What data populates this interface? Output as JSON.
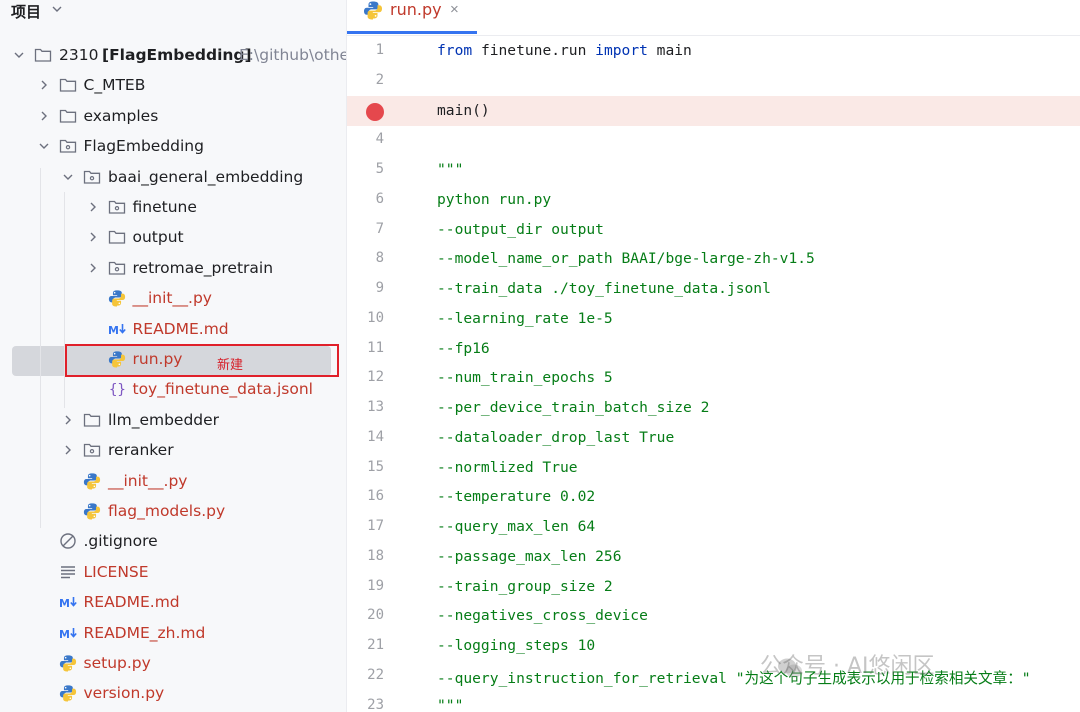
{
  "panel": {
    "title": "项目"
  },
  "tree": [
    {
      "label": "2310",
      "bold_label": "[FlagEmbedding]",
      "path": "E:\\github\\othe",
      "type": "folder",
      "depth": 0,
      "expanded": true
    },
    {
      "label": "C_MTEB",
      "type": "folder",
      "depth": 1,
      "expanded": false
    },
    {
      "label": "examples",
      "type": "folder",
      "depth": 1,
      "expanded": false
    },
    {
      "label": "FlagEmbedding",
      "type": "package",
      "depth": 1,
      "expanded": true
    },
    {
      "label": "baai_general_embedding",
      "type": "package",
      "depth": 2,
      "expanded": true
    },
    {
      "label": "finetune",
      "type": "package",
      "depth": 3,
      "expanded": false
    },
    {
      "label": "output",
      "type": "folder",
      "depth": 3,
      "expanded": false
    },
    {
      "label": "retromae_pretrain",
      "type": "package",
      "depth": 3,
      "expanded": false
    },
    {
      "label": "__init__.py",
      "type": "python",
      "depth": 3
    },
    {
      "label": "README.md",
      "type": "markdown",
      "depth": 3
    },
    {
      "label": "run.py",
      "type": "python",
      "depth": 3,
      "selected": true
    },
    {
      "label": "toy_finetune_data.jsonl",
      "type": "json",
      "depth": 3
    },
    {
      "label": "llm_embedder",
      "type": "folder",
      "depth": 2,
      "expanded": false
    },
    {
      "label": "reranker",
      "type": "package",
      "depth": 2,
      "expanded": false
    },
    {
      "label": "__init__.py",
      "type": "python",
      "depth": 2
    },
    {
      "label": "flag_models.py",
      "type": "python",
      "depth": 2
    },
    {
      "label": ".gitignore",
      "type": "ignore",
      "depth": 1
    },
    {
      "label": "LICENSE",
      "type": "text",
      "depth": 1
    },
    {
      "label": "README.md",
      "type": "markdown",
      "depth": 1
    },
    {
      "label": "README_zh.md",
      "type": "markdown",
      "depth": 1
    },
    {
      "label": "setup.py",
      "type": "python",
      "depth": 1
    },
    {
      "label": "version.py",
      "type": "python",
      "depth": 1
    }
  ],
  "annotation": {
    "new_tag": "新建"
  },
  "editor": {
    "tab_label": "run.py",
    "tab_close": "×",
    "lines": [
      {
        "num": "1",
        "text": "from finetune.run import main",
        "kind": "code"
      },
      {
        "num": "2",
        "text": "",
        "kind": "code"
      },
      {
        "num": "3",
        "text": "main()",
        "kind": "code",
        "breakpoint": true
      },
      {
        "num": "4",
        "text": "",
        "kind": "code"
      },
      {
        "num": "5",
        "text": "\"\"\"",
        "kind": "str"
      },
      {
        "num": "6",
        "text": "python run.py",
        "kind": "str"
      },
      {
        "num": "7",
        "text": "--output_dir output",
        "kind": "str"
      },
      {
        "num": "8",
        "text": "--model_name_or_path BAAI/bge-large-zh-v1.5",
        "kind": "str"
      },
      {
        "num": "9",
        "text": "--train_data ./toy_finetune_data.jsonl",
        "kind": "str"
      },
      {
        "num": "10",
        "text": "--learning_rate 1e-5",
        "kind": "str"
      },
      {
        "num": "11",
        "text": "--fp16",
        "kind": "str"
      },
      {
        "num": "12",
        "text": "--num_train_epochs 5",
        "kind": "str"
      },
      {
        "num": "13",
        "text": "--per_device_train_batch_size 2",
        "kind": "str"
      },
      {
        "num": "14",
        "text": "--dataloader_drop_last True",
        "kind": "str"
      },
      {
        "num": "15",
        "text": "--normlized True",
        "kind": "str"
      },
      {
        "num": "16",
        "text": "--temperature 0.02",
        "kind": "str"
      },
      {
        "num": "17",
        "text": "--query_max_len 64",
        "kind": "str"
      },
      {
        "num": "18",
        "text": "--passage_max_len 256",
        "kind": "str"
      },
      {
        "num": "19",
        "text": "--train_group_size 2",
        "kind": "str"
      },
      {
        "num": "20",
        "text": "--negatives_cross_device",
        "kind": "str"
      },
      {
        "num": "21",
        "text": "--logging_steps 10",
        "kind": "str"
      },
      {
        "num": "22",
        "text": "--query_instruction_for_retrieval \"为这个句子生成表示以用于检索相关文章：\"",
        "kind": "str"
      },
      {
        "num": "23",
        "text": "\"\"\"",
        "kind": "str"
      }
    ]
  },
  "watermark": {
    "text": "公众号 · AI悠闲区"
  },
  "colors": {
    "keyword": "#0033b3",
    "string": "#067d17",
    "highlight_box": "#e0202a",
    "breakpoint": "#e5484d",
    "accent": "#3574f0"
  }
}
